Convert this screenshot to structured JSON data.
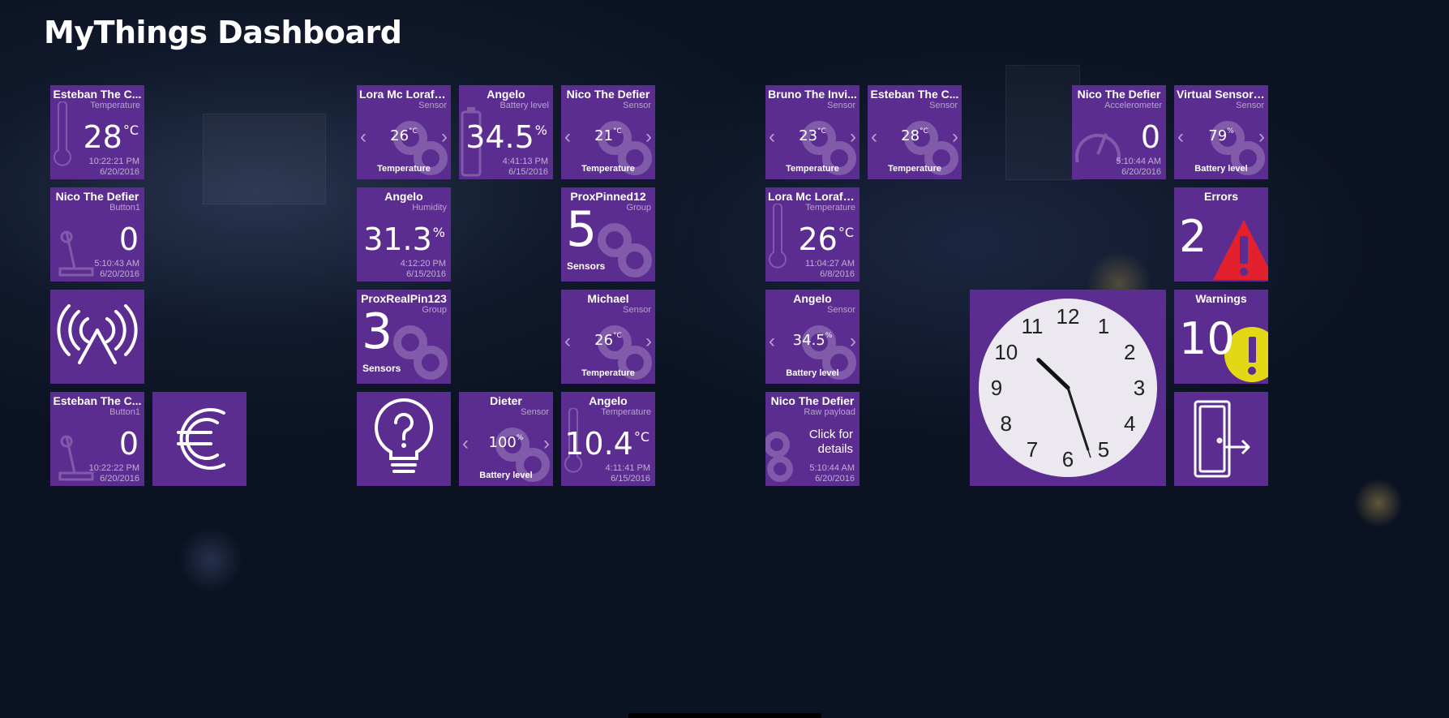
{
  "header": {
    "title": "MyThings Dashboard"
  },
  "tiles": {
    "t1": {
      "name": "Esteban The C...",
      "type": "Temperature",
      "value": "28",
      "unit": "°C",
      "time": "10:22:21 PM",
      "date": "6/20/2016"
    },
    "t2": {
      "name": "Nico The Defier",
      "type": "Button1",
      "value": "0",
      "time": "5:10:43 AM",
      "date": "6/20/2016"
    },
    "t3": {
      "name": "Esteban The C...",
      "type": "Button1",
      "value": "0",
      "time": "10:22:22 PM",
      "date": "6/20/2016"
    },
    "t4": {
      "name": "Lora Mc Lorafa...",
      "type": "Sensor",
      "value": "26",
      "unit": "°C",
      "label": "Temperature"
    },
    "t5": {
      "name": "Angelo",
      "type": "Battery level",
      "value": "34.5",
      "unit": "%",
      "time": "4:41:13 PM",
      "date": "6/15/2016"
    },
    "t6": {
      "name": "Nico The Defier",
      "type": "Sensor",
      "value": "21",
      "unit": "°C",
      "label": "Temperature"
    },
    "t7": {
      "name": "Angelo",
      "type": "Humidity",
      "value": "31.3",
      "unit": "%",
      "time": "4:12:20 PM",
      "date": "6/15/2016"
    },
    "t8": {
      "name": "ProxPinned12",
      "type": "Group",
      "count": "5",
      "label": "Sensors"
    },
    "t9": {
      "name": "ProxRealPin123",
      "type": "Group",
      "count": "3",
      "label": "Sensors"
    },
    "t10": {
      "name": "Michael",
      "type": "Sensor",
      "value": "26",
      "unit": "°C",
      "label": "Temperature"
    },
    "t11": {
      "name": "Dieter",
      "type": "Sensor",
      "value": "100",
      "unit": "%",
      "label": "Battery level"
    },
    "t12": {
      "name": "Angelo",
      "type": "Temperature",
      "value": "10.4",
      "unit": "°C",
      "time": "4:11:41 PM",
      "date": "6/15/2016"
    },
    "t13": {
      "name": "Bruno The Invi...",
      "type": "Sensor",
      "value": "23",
      "unit": "°C",
      "label": "Temperature"
    },
    "t14": {
      "name": "Esteban The C...",
      "type": "Sensor",
      "value": "28",
      "unit": "°C",
      "label": "Temperature"
    },
    "t15": {
      "name": "Lora Mc Lorafa...",
      "type": "Temperature",
      "value": "26",
      "unit": "°C",
      "time": "11:04:27 AM",
      "date": "6/8/2016"
    },
    "t16": {
      "name": "Angelo",
      "type": "Sensor",
      "value": "34.5",
      "unit": "%",
      "label": "Battery level"
    },
    "t17": {
      "name": "Nico The Defier",
      "type": "Raw payload",
      "line1": "Click for",
      "line2": "details",
      "time": "5:10:44 AM",
      "date": "6/20/2016"
    },
    "t18": {
      "name": "Nico The Defier",
      "type": "Accelerometer",
      "value": "0",
      "time": "5:10:44 AM",
      "date": "6/20/2016"
    },
    "t19": {
      "name": "Virtual Sensor ...",
      "type": "Sensor",
      "value": "79",
      "unit": "%",
      "label": "Battery level"
    },
    "errors": {
      "name": "Errors",
      "count": "2"
    },
    "warnings": {
      "name": "Warnings",
      "count": "10"
    }
  },
  "clock": {
    "numerals": [
      "12",
      "1",
      "2",
      "3",
      "4",
      "5",
      "6",
      "7",
      "8",
      "9",
      "10",
      "11"
    ],
    "hour": 10,
    "minute": 27,
    "second": 27
  },
  "icons": {
    "antenna": "antenna-icon",
    "euro": "euro-icon",
    "help": "help-bulb-icon",
    "logout": "logout-door-icon",
    "thermometer": "thermometer-icon",
    "joystick": "joystick-icon",
    "battery": "battery-icon",
    "gauge": "gauge-icon",
    "link": "link-icon"
  },
  "colors": {
    "tile": "#5c2d91",
    "error": "#e3202e",
    "warning": "#e3d816"
  }
}
